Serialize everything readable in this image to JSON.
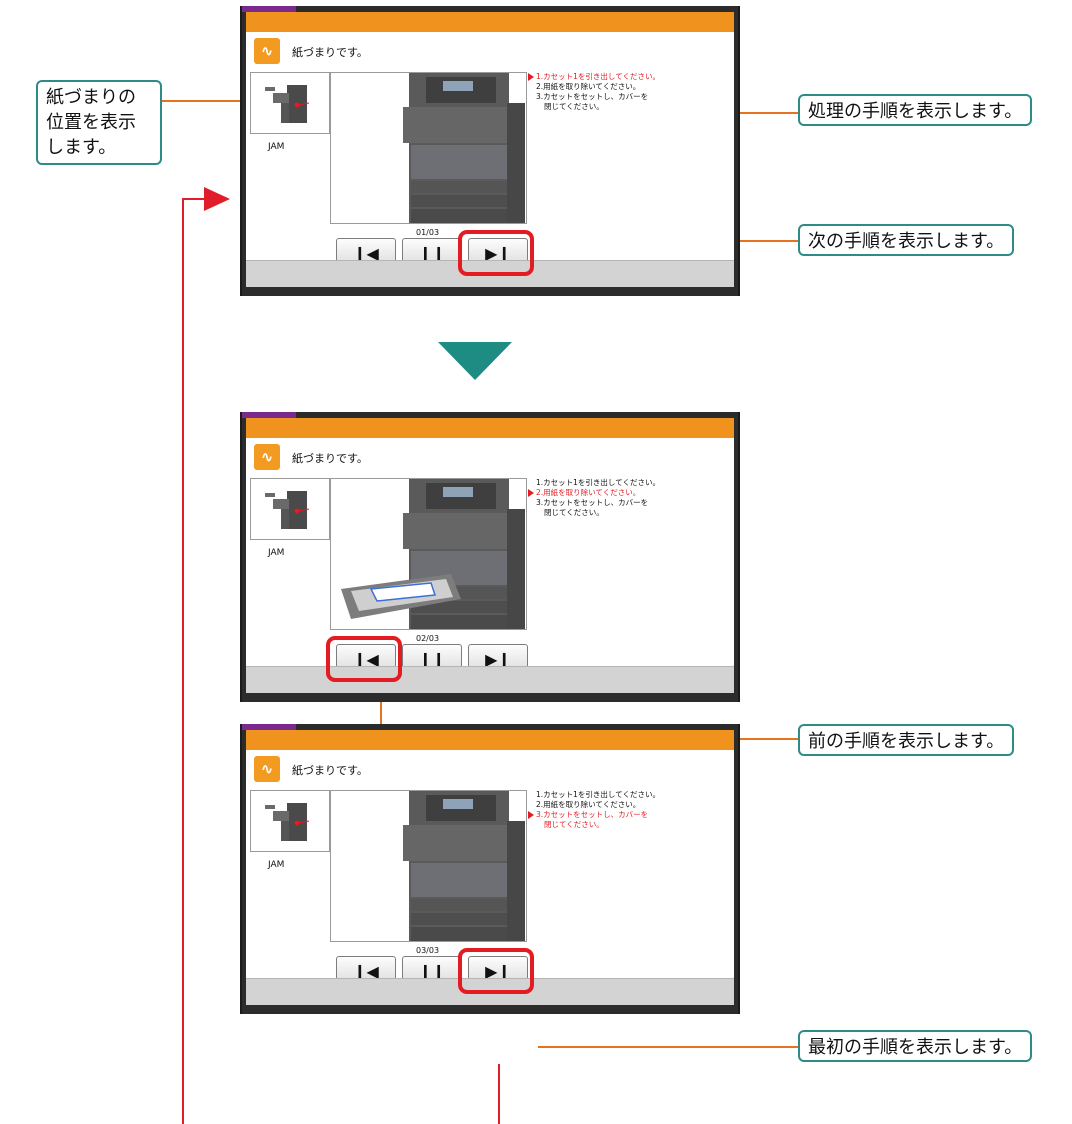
{
  "callouts": {
    "jam_location": "紙づまりの位置を表示します。",
    "procedure": "処理の手順を表示します。",
    "next_step": "次の手順を表示します。",
    "prev_step": "前の手順を表示します。",
    "first_step": "最初の手順を表示します。"
  },
  "panels": [
    {
      "title": "紙づまりです。",
      "thumb_label": "JAM",
      "counter": "01/03",
      "steps": [
        "1.カセット1を引き出してください。",
        "2.用紙を取り除いてください。",
        "3.カセットをセットし、カバーを",
        "閉じてください。"
      ]
    },
    {
      "title": "紙づまりです。",
      "thumb_label": "JAM",
      "counter": "02/03",
      "steps": [
        "1.カセット1を引き出してください。",
        "2.用紙を取り除いてください。",
        "3.カセットをセットし、カバーを",
        "閉じてください。"
      ]
    },
    {
      "title": "紙づまりです。",
      "thumb_label": "JAM",
      "counter": "03/03",
      "steps": [
        "1.カセット1を引き出してください。",
        "2.用紙を取り除いてください。",
        "3.カセットをセットし、カバーを",
        "閉じてください。"
      ]
    }
  ],
  "controls": {
    "prev_icon": "skip-previous-icon",
    "pause_icon": "pause-icon",
    "next_icon": "skip-next-icon"
  },
  "colors": {
    "accent_orange": "#f0921e",
    "highlight_red": "#e31b23",
    "callout_border": "#2e8b87",
    "arrow_teal": "#1e8c82"
  }
}
